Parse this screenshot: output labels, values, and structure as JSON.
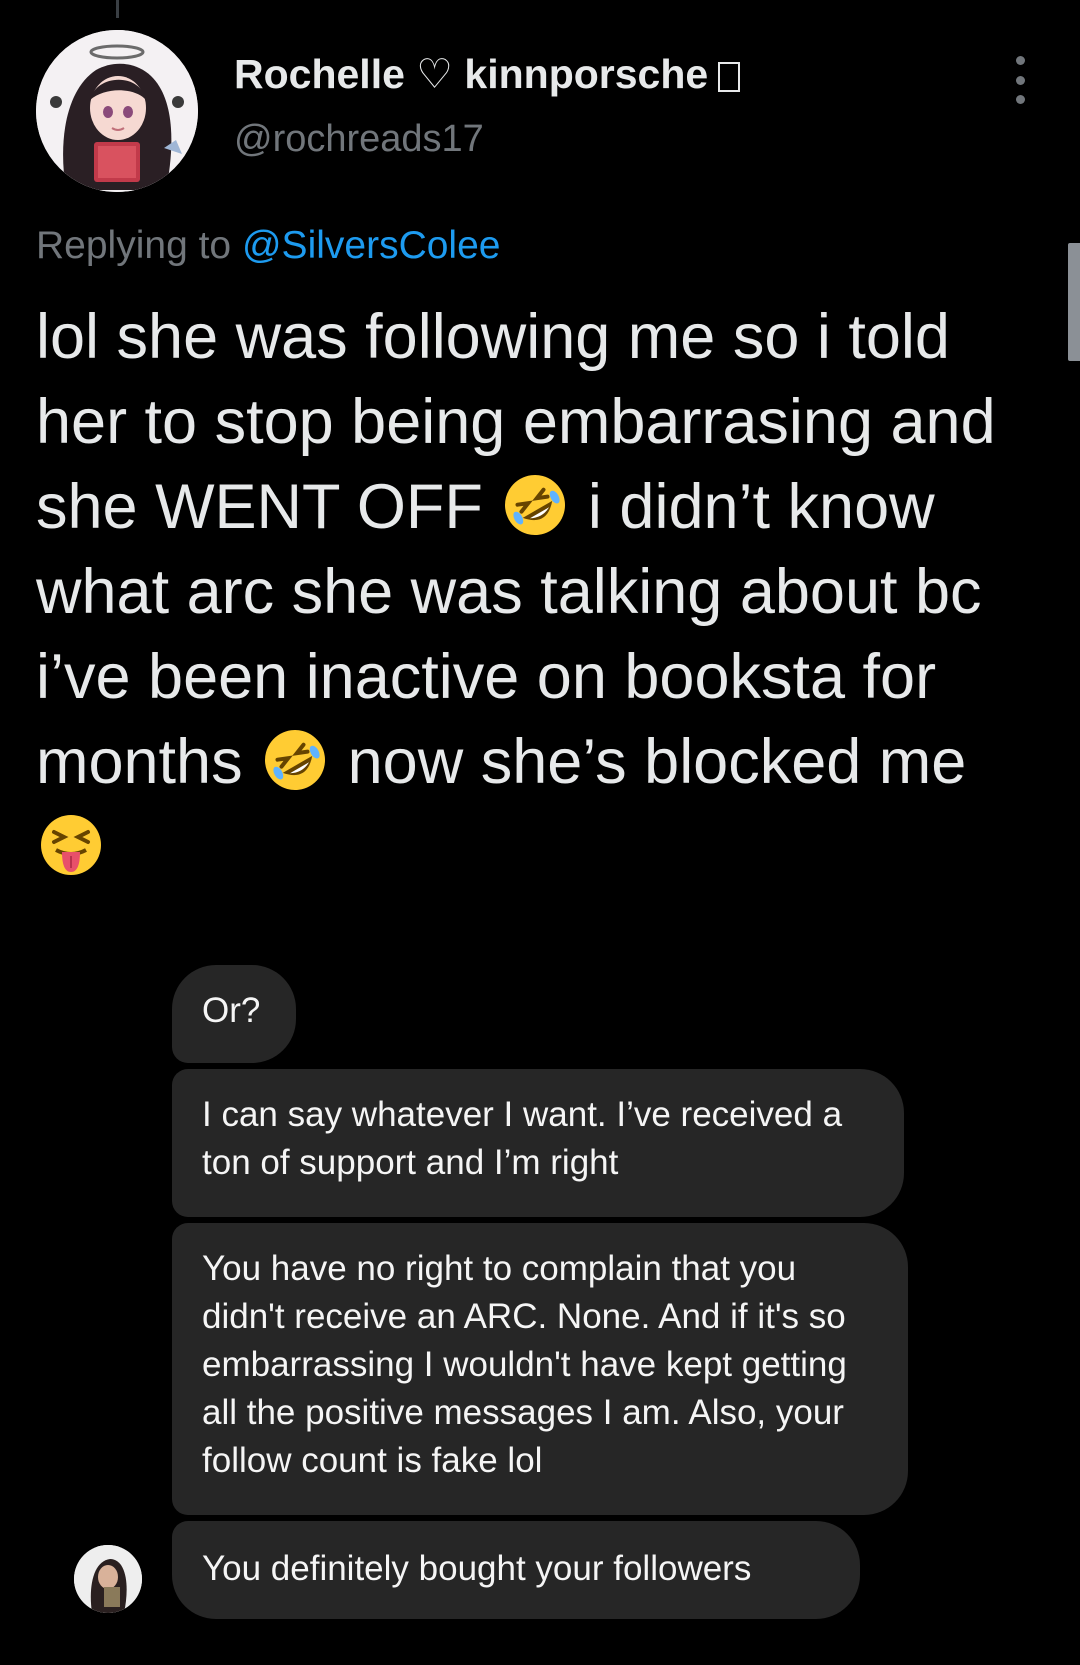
{
  "tweet": {
    "display_name": "Rochelle ♡ kinnporsche",
    "handle": "@rochreads17",
    "replying_prefix": "Replying to",
    "replying_mention": "@SilversColee",
    "text_parts": {
      "p1": "lol she was following me so i told her to stop being embarrasing and she WENT OFF",
      "p2": "i didn’t know what arc she was talking about bc i’ve been inactive on booksta for months",
      "p3": "now she’s blocked me"
    },
    "icons": {
      "laughing": "rolling-on-floor-laughing-emoji",
      "tongue": "squinting-face-with-tongue-emoji",
      "more": "more-options-icon"
    }
  },
  "dm": {
    "messages": [
      "Or?",
      "I can say whatever I want. I’ve received a ton of support and I’m right",
      "You have  no right to complain that you didn't receive an ARC. None. And if it's so embarrassing I wouldn't have kept getting all the positive messages I am. Also, your follow count is fake lol",
      "You definitely bought your followers"
    ]
  },
  "colors": {
    "background": "#000000",
    "text": "#e7e9ea",
    "secondary": "#71767b",
    "link": "#1d9bf0",
    "bubble": "#262626"
  }
}
